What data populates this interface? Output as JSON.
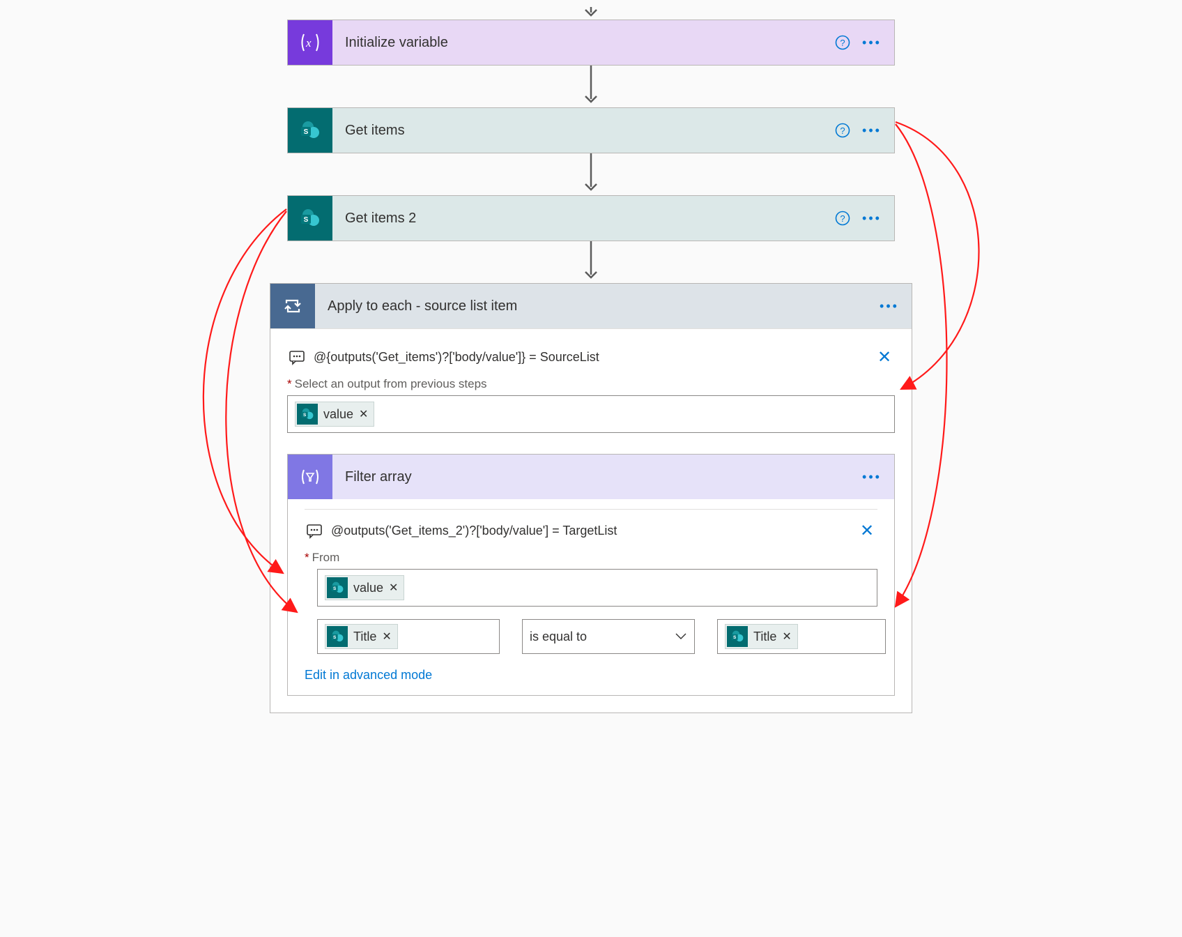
{
  "steps": {
    "init_var": {
      "title": "Initialize variable"
    },
    "get_items": {
      "title": "Get items"
    },
    "get_items2": {
      "title": "Get items 2"
    },
    "apply_each": {
      "title": "Apply to each - source list item",
      "expression": "@{outputs('Get_items')?['body/value']} = SourceList",
      "select_label": "Select an output from previous steps",
      "token": "value"
    },
    "filter": {
      "title": "Filter array",
      "expression": "@outputs('Get_items_2')?['body/value'] = TargetList",
      "from_label": "From",
      "from_token": "value",
      "left_token": "Title",
      "operator": "is equal to",
      "right_token": "Title",
      "advanced": "Edit in advanced mode"
    }
  }
}
